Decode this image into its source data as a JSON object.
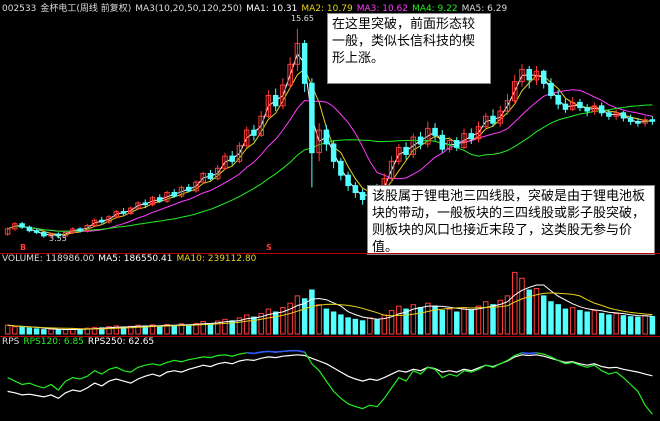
{
  "header": {
    "code": "002533",
    "name": "金杯电工(周线 前复权)",
    "ma_label": "MA3(10,20,50,120,250)",
    "ma1": "MA1: 10.31",
    "ma2": "MA2: 10.79",
    "ma3": "MA3: 10.62",
    "ma4": "MA4: 9.22",
    "ma5": "MA5: 6.29"
  },
  "volume_header": {
    "volume": "VOLUME: 118986.00",
    "ma5": "MA5: 186550.41",
    "ma10": "MA10: 239112.80"
  },
  "rps_header": {
    "title": "RPS",
    "rps120": "RPS120: 6.85",
    "rps250": "RPS250: 62.65"
  },
  "annotations": {
    "high_price": "15.65",
    "low_price": "3.55",
    "marker_1": "B",
    "marker_2": "S",
    "note_top": "在这里突破，前面形态较一般，类似长信科技的楔形上涨。",
    "note_bottom": "该股属于锂电池三四线股，突破是由于锂电池板块的带动，一般板块的三四线股或影子股突破，则板块的风口也接近末段了，这类股无参与价值。"
  },
  "colors": {
    "up": "#ff3b3b",
    "down": "#54ffff",
    "ma1": "#ffffff",
    "ma2": "#e6d21e",
    "ma3": "#ff3cff",
    "ma4": "#22ee22",
    "ma5": "#aaaaaa",
    "vol_ma5": "#ffffff",
    "vol_ma10": "#e6d21e",
    "rps120": "#22ee22",
    "rps250": "#ffffff",
    "rps_high": "#3355ff"
  },
  "chart_data": {
    "type": "candlestick",
    "periodicity": "weekly",
    "ylim": [
      3.0,
      16.5
    ],
    "high": 15.65,
    "low": 3.55,
    "candles": [
      [
        3.8,
        4.1,
        3.7,
        4.2
      ],
      [
        4.1,
        4.4,
        4.0,
        4.5
      ],
      [
        4.4,
        4.2,
        4.1,
        4.5
      ],
      [
        4.2,
        4.0,
        3.9,
        4.3
      ],
      [
        4.0,
        3.9,
        3.8,
        4.1
      ],
      [
        3.9,
        3.7,
        3.6,
        4.0
      ],
      [
        3.7,
        3.8,
        3.6,
        3.9
      ],
      [
        3.8,
        3.7,
        3.55,
        3.9
      ],
      [
        3.7,
        3.9,
        3.6,
        4.0
      ],
      [
        3.9,
        4.1,
        3.8,
        4.2
      ],
      [
        4.1,
        4.0,
        3.9,
        4.2
      ],
      [
        4.0,
        4.3,
        3.9,
        4.4
      ],
      [
        4.3,
        4.6,
        4.2,
        4.7
      ],
      [
        4.6,
        4.5,
        4.4,
        4.8
      ],
      [
        4.5,
        4.8,
        4.4,
        4.9
      ],
      [
        4.8,
        5.1,
        4.7,
        5.2
      ],
      [
        5.1,
        5.0,
        4.9,
        5.3
      ],
      [
        5.0,
        5.3,
        4.9,
        5.4
      ],
      [
        5.3,
        5.6,
        5.2,
        5.7
      ],
      [
        5.6,
        5.5,
        5.3,
        5.8
      ],
      [
        5.5,
        5.9,
        5.4,
        6.0
      ],
      [
        5.9,
        5.7,
        5.6,
        6.1
      ],
      [
        5.7,
        6.2,
        5.6,
        6.3
      ],
      [
        6.2,
        6.0,
        5.9,
        6.4
      ],
      [
        6.0,
        6.5,
        5.9,
        6.6
      ],
      [
        6.5,
        6.3,
        6.2,
        6.7
      ],
      [
        6.3,
        6.8,
        6.2,
        6.9
      ],
      [
        6.8,
        7.3,
        6.7,
        7.4
      ],
      [
        7.3,
        7.0,
        6.9,
        7.5
      ],
      [
        7.0,
        7.6,
        6.9,
        7.8
      ],
      [
        7.6,
        8.3,
        7.5,
        8.5
      ],
      [
        8.3,
        8.0,
        7.8,
        8.6
      ],
      [
        8.0,
        8.9,
        7.9,
        9.1
      ],
      [
        8.9,
        9.8,
        8.8,
        10.0
      ],
      [
        9.8,
        9.5,
        9.2,
        10.1
      ],
      [
        9.5,
        10.6,
        9.4,
        10.9
      ],
      [
        10.6,
        11.8,
        10.5,
        12.1
      ],
      [
        11.8,
        11.2,
        10.9,
        12.2
      ],
      [
        11.2,
        12.4,
        11.0,
        12.8
      ],
      [
        12.4,
        13.6,
        12.2,
        14.0
      ],
      [
        13.6,
        14.8,
        13.2,
        15.65
      ],
      [
        14.8,
        12.5,
        12.0,
        15.0
      ],
      [
        12.5,
        8.5,
        6.5,
        12.8
      ],
      [
        8.5,
        9.8,
        8.0,
        10.2
      ],
      [
        9.8,
        9.0,
        8.6,
        10.1
      ],
      [
        9.0,
        8.0,
        7.6,
        9.2
      ],
      [
        8.0,
        7.2,
        6.9,
        8.2
      ],
      [
        7.2,
        6.6,
        6.3,
        7.4
      ],
      [
        6.6,
        6.2,
        5.9,
        6.8
      ],
      [
        6.2,
        5.8,
        5.5,
        6.4
      ],
      [
        5.8,
        6.4,
        5.6,
        6.6
      ],
      [
        6.4,
        6.0,
        5.8,
        6.7
      ],
      [
        6.0,
        7.0,
        5.9,
        7.3
      ],
      [
        7.0,
        8.0,
        6.8,
        8.3
      ],
      [
        8.0,
        8.8,
        7.8,
        9.0
      ],
      [
        8.8,
        8.4,
        8.1,
        9.1
      ],
      [
        8.4,
        9.4,
        8.2,
        9.6
      ],
      [
        9.4,
        9.0,
        8.7,
        9.7
      ],
      [
        9.0,
        9.9,
        8.8,
        10.3
      ],
      [
        9.9,
        9.5,
        9.2,
        10.2
      ],
      [
        9.5,
        8.7,
        8.5,
        9.8
      ],
      [
        8.7,
        9.2,
        8.5,
        9.4
      ],
      [
        9.2,
        8.8,
        8.6,
        9.4
      ],
      [
        8.8,
        9.6,
        8.7,
        9.9
      ],
      [
        9.6,
        9.3,
        9.0,
        9.9
      ],
      [
        9.3,
        10.0,
        9.1,
        10.3
      ],
      [
        10.0,
        10.6,
        9.8,
        10.8
      ],
      [
        10.6,
        10.2,
        10.0,
        11.0
      ],
      [
        10.2,
        10.9,
        10.0,
        11.2
      ],
      [
        10.9,
        11.5,
        10.7,
        11.9
      ],
      [
        11.5,
        12.6,
        11.3,
        13.0
      ],
      [
        12.6,
        13.3,
        12.3,
        13.6
      ],
      [
        13.3,
        12.7,
        12.2,
        13.5
      ],
      [
        12.7,
        13.2,
        12.4,
        13.5
      ],
      [
        13.2,
        12.5,
        12.2,
        13.3
      ],
      [
        12.5,
        11.8,
        11.6,
        12.8
      ],
      [
        11.8,
        11.3,
        11.0,
        12.1
      ],
      [
        11.3,
        11.0,
        10.8,
        11.6
      ],
      [
        11.0,
        11.4,
        10.9,
        11.7
      ],
      [
        11.4,
        11.1,
        10.9,
        11.6
      ],
      [
        11.1,
        10.9,
        10.6,
        11.3
      ],
      [
        10.9,
        11.2,
        10.7,
        11.4
      ],
      [
        11.2,
        10.8,
        10.6,
        11.4
      ],
      [
        10.8,
        10.6,
        10.4,
        11.0
      ],
      [
        10.6,
        10.8,
        10.4,
        11.0
      ],
      [
        10.8,
        10.5,
        10.3,
        10.9
      ],
      [
        10.5,
        10.3,
        10.1,
        10.7
      ],
      [
        10.3,
        10.2,
        10.0,
        10.5
      ],
      [
        10.2,
        10.4,
        10.0,
        10.6
      ],
      [
        10.4,
        10.31,
        10.1,
        10.6
      ]
    ],
    "ma_last": {
      "ma1": 10.31,
      "ma2": 10.79,
      "ma3": 10.62,
      "ma4": 9.22,
      "ma5": 6.29
    },
    "volume": [
      60,
      50,
      45,
      40,
      35,
      30,
      32,
      28,
      30,
      35,
      33,
      40,
      45,
      42,
      50,
      55,
      48,
      52,
      60,
      55,
      62,
      55,
      65,
      58,
      70,
      62,
      72,
      85,
      70,
      88,
      100,
      90,
      110,
      130,
      115,
      140,
      170,
      150,
      180,
      210,
      260,
      240,
      300,
      200,
      170,
      150,
      130,
      110,
      100,
      90,
      110,
      95,
      130,
      160,
      190,
      170,
      200,
      180,
      210,
      190,
      160,
      170,
      150,
      180,
      165,
      190,
      220,
      200,
      230,
      260,
      420,
      380,
      300,
      310,
      260,
      220,
      200,
      170,
      180,
      160,
      150,
      160,
      140,
      130,
      140,
      125,
      118,
      115,
      125,
      118.986
    ],
    "volume_ylim": [
      0,
      450
    ],
    "rps120": [
      60,
      55,
      50,
      52,
      48,
      45,
      50,
      42,
      55,
      60,
      58,
      62,
      70,
      65,
      72,
      75,
      70,
      68,
      75,
      78,
      80,
      78,
      82,
      85,
      83,
      86,
      88,
      90,
      89,
      92,
      93,
      91,
      94,
      96,
      95,
      97,
      98,
      97,
      98,
      99,
      99,
      97,
      80,
      70,
      55,
      40,
      30,
      22,
      18,
      15,
      20,
      18,
      30,
      45,
      60,
      55,
      70,
      65,
      75,
      72,
      60,
      65,
      62,
      70,
      68,
      72,
      78,
      75,
      80,
      85,
      92,
      96,
      95,
      96,
      94,
      90,
      85,
      80,
      82,
      78,
      75,
      78,
      70,
      65,
      68,
      60,
      50,
      40,
      20,
      6.85
    ],
    "rps250": [
      40,
      38,
      35,
      36,
      34,
      32,
      35,
      30,
      38,
      42,
      40,
      45,
      52,
      48,
      55,
      58,
      55,
      52,
      58,
      62,
      65,
      62,
      68,
      70,
      68,
      72,
      75,
      78,
      76,
      80,
      82,
      80,
      84,
      86,
      85,
      88,
      90,
      89,
      91,
      92,
      93,
      92,
      88,
      84,
      80,
      74,
      68,
      62,
      58,
      55,
      58,
      56,
      60,
      65,
      70,
      68,
      72,
      70,
      75,
      73,
      68,
      70,
      68,
      72,
      70,
      74,
      78,
      76,
      80,
      84,
      90,
      93,
      92,
      93,
      91,
      88,
      85,
      82,
      83,
      80,
      78,
      80,
      76,
      74,
      75,
      72,
      70,
      68,
      65,
      62.65
    ],
    "rps_ylim": [
      0,
      100
    ]
  }
}
